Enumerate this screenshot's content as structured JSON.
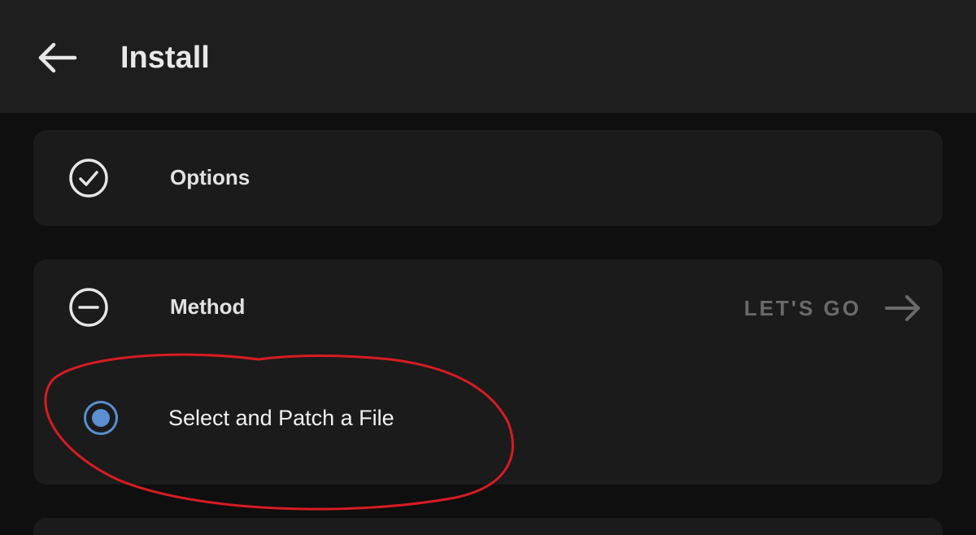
{
  "header": {
    "title": "Install",
    "back_icon": "arrow-left-icon"
  },
  "options_card": {
    "label": "Options",
    "icon": "check-circle-icon"
  },
  "method_card": {
    "label": "Method",
    "icon": "minus-circle-icon",
    "action_label": "LET'S GO",
    "action_icon": "arrow-right-icon",
    "selected_option": "Select and Patch a File",
    "radio_checked": true
  },
  "colors": {
    "background": "#0f0f0f",
    "topbar": "#1e1e1e",
    "card": "#1b1b1b",
    "text": "#e2e2e2",
    "muted": "#6a6a6a",
    "accent": "#5a8fd0",
    "annotation": "#d81c22"
  }
}
